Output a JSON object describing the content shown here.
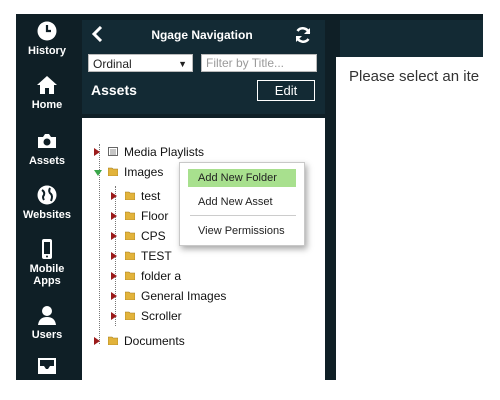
{
  "rail": {
    "items": [
      {
        "label": "History",
        "icon": "clock-icon"
      },
      {
        "label": "Home",
        "icon": "home-icon"
      },
      {
        "label": "Assets",
        "icon": "camera-icon"
      },
      {
        "label": "Websites",
        "icon": "globe-icon"
      },
      {
        "label": "Mobile Apps",
        "label_line1": "Mobile",
        "label_line2": "Apps",
        "icon": "phone-icon"
      },
      {
        "label": "Users",
        "icon": "user-icon"
      },
      {
        "label": "",
        "icon": "inbox-icon"
      }
    ]
  },
  "nav": {
    "title": "Ngage Navigation",
    "sort_select": {
      "value": "Ordinal"
    },
    "filter": {
      "placeholder": "Filter by Title...",
      "value": ""
    },
    "section_label": "Assets",
    "edit_label": "Edit"
  },
  "tree": {
    "items": [
      {
        "label": "Media Playlists",
        "icon": "playlist-icon",
        "state": "collapsed"
      },
      {
        "label": "Images",
        "icon": "folder-icon",
        "state": "expanded"
      },
      {
        "label": "test",
        "icon": "folder-icon",
        "state": "collapsed"
      },
      {
        "label": "Floor",
        "icon": "folder-icon",
        "state": "collapsed"
      },
      {
        "label": "CPS",
        "icon": "folder-icon",
        "state": "collapsed"
      },
      {
        "label": "TEST",
        "icon": "folder-icon",
        "state": "collapsed"
      },
      {
        "label": "folder a",
        "icon": "folder-icon",
        "state": "collapsed"
      },
      {
        "label": "General Images",
        "icon": "folder-icon",
        "state": "collapsed"
      },
      {
        "label": "Scroller",
        "icon": "folder-icon",
        "state": "collapsed"
      },
      {
        "label": "Documents",
        "icon": "folder-icon",
        "state": "collapsed"
      }
    ]
  },
  "context_menu": {
    "items": [
      {
        "label": "Add New Folder",
        "highlighted": true
      },
      {
        "label": "Add New Asset",
        "highlighted": false
      },
      {
        "label": "View Permissions",
        "highlighted": false
      }
    ]
  },
  "main": {
    "message": "Please select an ite"
  },
  "colors": {
    "dark_bg": "#0f1f26",
    "panel_bg": "#132a34",
    "menu_highlight": "#a8e08e",
    "expander_collapsed": "#9b1b1b",
    "expander_expanded": "#3aa64a",
    "folder": "#e2b33b"
  }
}
